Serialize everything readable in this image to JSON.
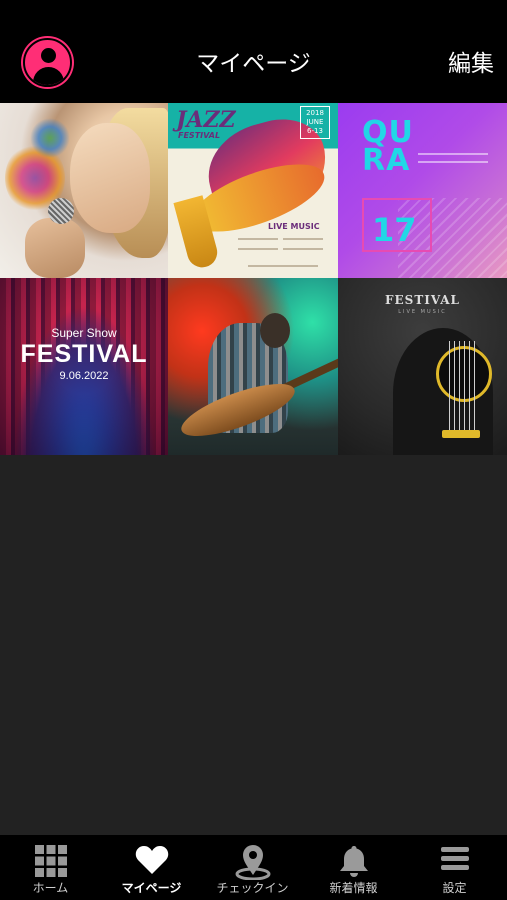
{
  "header": {
    "title": "マイページ",
    "edit_label": "編集",
    "accent_color": "#ff2e76"
  },
  "grid": {
    "items": [
      {
        "icon": "singer-photo"
      },
      {
        "icon": "jazz-festival-poster",
        "title": "JAZZ",
        "subtitle": "FESTIVAL",
        "date": "2018 JUNE 6-13",
        "tagline": "LIVE MUSIC"
      },
      {
        "icon": "qura-poster",
        "brand": "QU RA",
        "number": "17"
      },
      {
        "icon": "super-show-festival-poster",
        "kicker": "Super Show",
        "title": "FESTIVAL",
        "date": "9.06.2022"
      },
      {
        "icon": "bass-guitarist-photo"
      },
      {
        "icon": "guitar-festival-poster",
        "title": "FESTIVAL",
        "subtitle": "LIVE MUSIC"
      }
    ]
  },
  "tabbar": {
    "items": [
      {
        "label": "ホーム",
        "icon": "grid-icon",
        "active": false
      },
      {
        "label": "マイページ",
        "icon": "heart-icon",
        "active": true
      },
      {
        "label": "チェックイン",
        "icon": "location-pin-icon",
        "active": false
      },
      {
        "label": "新着情報",
        "icon": "bell-icon",
        "active": false
      },
      {
        "label": "設定",
        "icon": "menu-icon",
        "active": false
      }
    ]
  }
}
